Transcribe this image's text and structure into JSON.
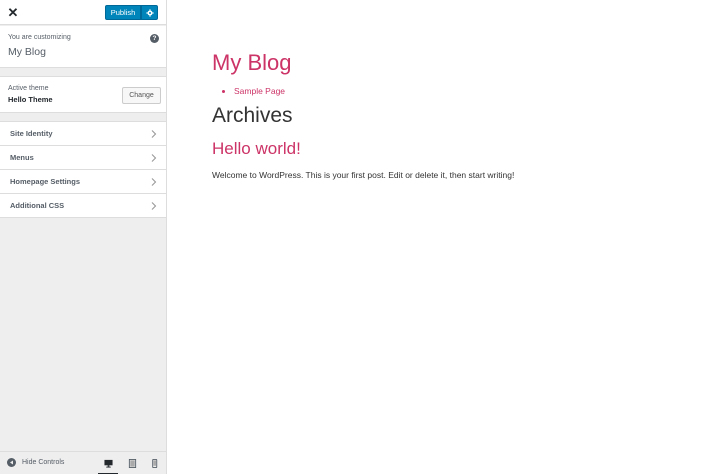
{
  "topbar": {
    "close_icon": "close-icon",
    "publish_label": "Publish",
    "settings_icon": "gear-icon"
  },
  "customizing": {
    "label": "You are customizing",
    "site_name": "My Blog",
    "help_glyph": "?"
  },
  "theme": {
    "label": "Active theme",
    "name": "Hello Theme",
    "change_label": "Change"
  },
  "panels": [
    {
      "label": "Site Identity"
    },
    {
      "label": "Menus"
    },
    {
      "label": "Homepage Settings"
    },
    {
      "label": "Additional CSS"
    }
  ],
  "footer": {
    "hide_label": "Hide Controls",
    "devices": [
      "desktop",
      "tablet",
      "mobile"
    ],
    "active_device": "desktop"
  },
  "preview": {
    "site_title": "My Blog",
    "nav": [
      "Sample Page"
    ],
    "archive_heading": "Archives",
    "post_title": "Hello world!",
    "post_excerpt": "Welcome to WordPress. This is your first post. Edit or delete it, then start writing!"
  },
  "colors": {
    "accent": "#0085ba",
    "link": "#cc3366",
    "sidebar_bg": "#eeeeee"
  }
}
